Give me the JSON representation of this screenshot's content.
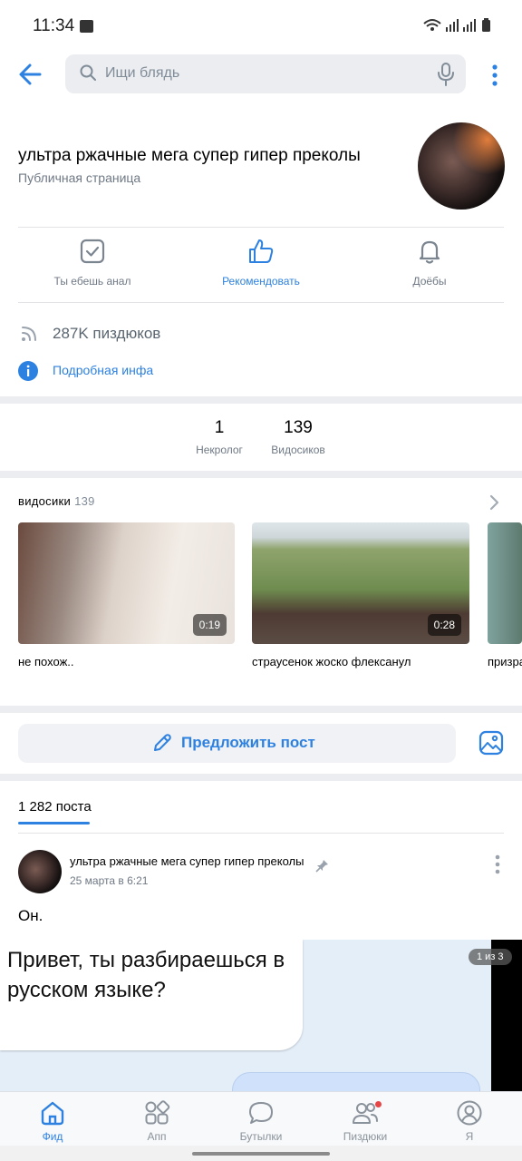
{
  "status_bar": {
    "time": "11:34"
  },
  "search": {
    "placeholder": "Ищи блядь"
  },
  "profile": {
    "title": "ультра ржачные мега супер гипер преколы",
    "subtitle": "Публичная страница"
  },
  "actions": [
    {
      "label": "Ты ебешь анал",
      "icon": "checkmark-square-icon"
    },
    {
      "label": "Рекомендовать",
      "icon": "thumbs-up-icon"
    },
    {
      "label": "Доёбы",
      "icon": "bell-icon"
    }
  ],
  "info": {
    "followers": "287K пиздюков",
    "details_link": "Подробная инфа"
  },
  "counters": [
    {
      "num": "1",
      "cap": "Некролог"
    },
    {
      "num": "139",
      "cap": "Видосиков"
    }
  ],
  "videos": {
    "title": "видосики",
    "count": "139",
    "items": [
      {
        "title": "не похож..",
        "duration": "0:19"
      },
      {
        "title": "страусенок жоско флексанул",
        "duration": "0:28"
      },
      {
        "title": "призра",
        "duration": ""
      }
    ]
  },
  "suggest": {
    "label": "Предложить пост"
  },
  "posts": {
    "tab_label": "1 282 поста",
    "post": {
      "author": "ультра ржачные мега супер гипер преколы",
      "date": "25 марта в 6:21",
      "text": "Он.",
      "image_text": "Привет, ты разбираешься в русском языке?",
      "page_indicator": "1 из 3"
    }
  },
  "nav": [
    {
      "label": "Фид",
      "icon": "home-icon",
      "active": true
    },
    {
      "label": "Апп",
      "icon": "apps-icon",
      "active": false
    },
    {
      "label": "Бутылки",
      "icon": "chat-bubble-icon",
      "active": false
    },
    {
      "label": "Пиздюки",
      "icon": "friends-icon",
      "active": false
    },
    {
      "label": "Я",
      "icon": "profile-icon",
      "active": false
    }
  ],
  "colors": {
    "accent": "#2d81e0",
    "secondary_text": "#6f7985",
    "separator": "#ebedf0"
  }
}
